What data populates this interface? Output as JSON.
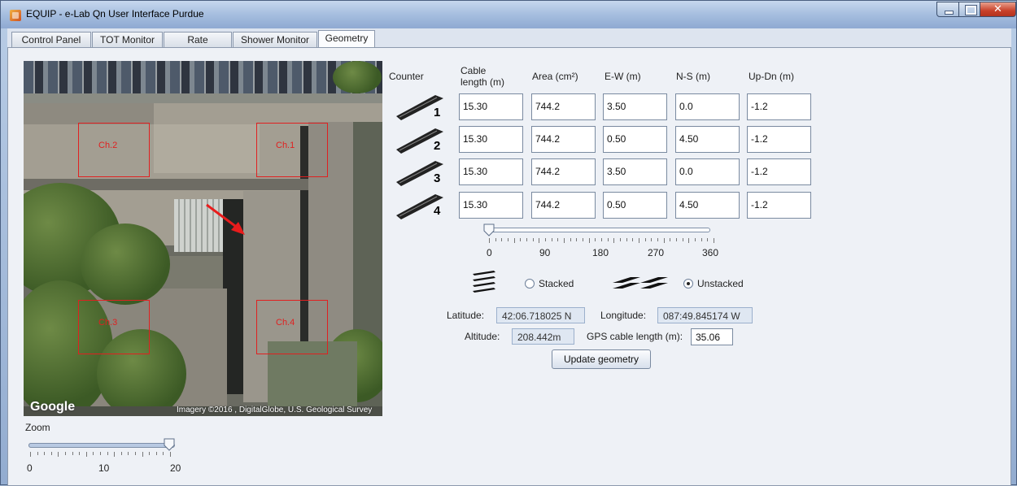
{
  "window": {
    "title": "EQUIP - e-Lab Qn User Interface Purdue"
  },
  "tabs": [
    {
      "label": "Control Panel"
    },
    {
      "label": "TOT Monitor"
    },
    {
      "label": "Rate Monitor"
    },
    {
      "label": "Shower Monitor"
    },
    {
      "label": "Geometry"
    }
  ],
  "active_tab": "Geometry",
  "map": {
    "channels": [
      "Ch.2",
      "Ch.1",
      "Ch.3",
      "Ch.4"
    ],
    "brand": "Google",
    "credit": "Imagery ©2016 , DigitalGlobe, U.S. Geological Survey"
  },
  "zoom": {
    "label": "Zoom",
    "ticks": [
      "0",
      "10",
      "20"
    ],
    "value": 20,
    "min": 0,
    "max": 20
  },
  "table": {
    "headers": {
      "counter": "Counter",
      "cable": "Cable\nlength (m)",
      "area": "Area (cm²)",
      "ew": "E-W (m)",
      "ns": "N-S (m)",
      "updn": "Up-Dn (m)"
    },
    "rows": [
      {
        "counter": "1",
        "cable": "15.30",
        "area": "744.2",
        "ew": "3.50",
        "ns": "0.0",
        "updn": "-1.2"
      },
      {
        "counter": "2",
        "cable": "15.30",
        "area": "744.2",
        "ew": "0.50",
        "ns": "4.50",
        "updn": "-1.2"
      },
      {
        "counter": "3",
        "cable": "15.30",
        "area": "744.2",
        "ew": "3.50",
        "ns": "0.0",
        "updn": "-1.2"
      },
      {
        "counter": "4",
        "cable": "15.30",
        "area": "744.2",
        "ew": "0.50",
        "ns": "4.50",
        "updn": "-1.2"
      }
    ]
  },
  "rotation": {
    "ticks": [
      "0",
      "90",
      "180",
      "270",
      "360"
    ],
    "value": 0,
    "min": 0,
    "max": 360
  },
  "stacking": {
    "stacked_label": "Stacked",
    "unstacked_label": "Unstacked",
    "selected": "Unstacked"
  },
  "gps": {
    "latitude_label": "Latitude:",
    "latitude": "42:06.718025 N",
    "longitude_label": "Longitude:",
    "longitude": "087:49.845174 W",
    "altitude_label": "Altitude:",
    "altitude": "208.442m",
    "cable_label": "GPS cable length (m):",
    "cable": "35.06"
  },
  "update_button": "Update geometry",
  "colors": {
    "channel_box": "#e02020",
    "title_gradient": "#a8c0e0",
    "close_button": "#c8412a"
  }
}
